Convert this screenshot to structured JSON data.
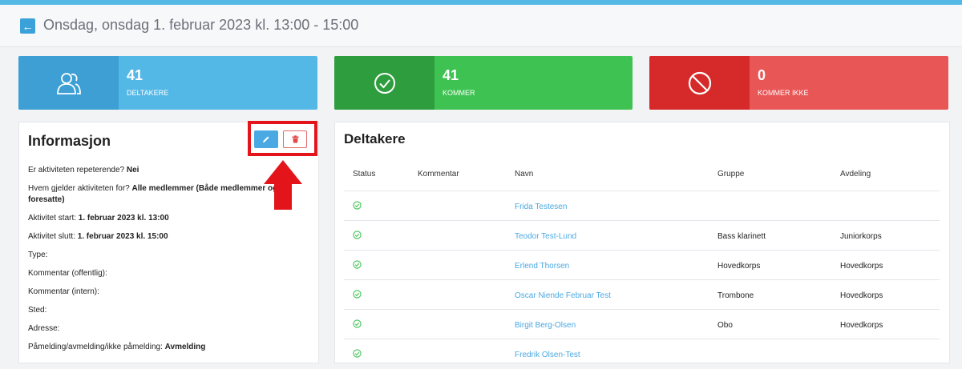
{
  "header": {
    "title": "Onsdag, onsdag 1. februar 2023 kl. 13:00 - 15:00",
    "back_icon": "arrow-left-icon"
  },
  "stats": [
    {
      "value": "41",
      "label": "DELTAKERE",
      "icon": "users-icon",
      "color": "#54b8e7"
    },
    {
      "value": "41",
      "label": "KOMMER",
      "icon": "check-circle-icon",
      "color": "#3ec252"
    },
    {
      "value": "0",
      "label": "KOMMER IKKE",
      "icon": "ban-icon",
      "color": "#e95656"
    }
  ],
  "info": {
    "title": "Informasjon",
    "rows": [
      {
        "label": "Er aktiviteten repeterende? ",
        "value": "Nei"
      },
      {
        "label": "Hvem gjelder aktiviteten for? ",
        "value": "Alle medlemmer (Både medlemmer og foresatte)"
      },
      {
        "label": "Aktivitet start: ",
        "value": "1. februar 2023 kl. 13:00"
      },
      {
        "label": "Aktivitet slutt: ",
        "value": "1. februar 2023 kl. 15:00"
      },
      {
        "label": "Type:",
        "value": ""
      },
      {
        "label": "Kommentar (offentlig):",
        "value": ""
      },
      {
        "label": "Kommentar (intern):",
        "value": ""
      },
      {
        "label": "Sted:",
        "value": ""
      },
      {
        "label": "Adresse:",
        "value": ""
      },
      {
        "label": "Påmelding/avmelding/ikke påmelding: ",
        "value": "Avmelding"
      }
    ]
  },
  "participants": {
    "title": "Deltakere",
    "columns": [
      "Status",
      "Kommentar",
      "Navn",
      "Gruppe",
      "Avdeling"
    ],
    "rows": [
      {
        "name": "Frida Testesen",
        "group": "",
        "department": ""
      },
      {
        "name": "Teodor Test-Lund",
        "group": "Bass klarinett",
        "department": "Juniorkorps"
      },
      {
        "name": "Erlend Thorsen",
        "group": "Hovedkorps",
        "department": "Hovedkorps"
      },
      {
        "name": "Oscar Niende Februar Test",
        "group": "Trombone",
        "department": "Hovedkorps"
      },
      {
        "name": "Birgit Berg-Olsen",
        "group": "Obo",
        "department": "Hovedkorps"
      },
      {
        "name": "Fredrik Olsen-Test",
        "group": "",
        "department": ""
      }
    ]
  },
  "colors": {
    "accent": "#4aa9e2",
    "highlight": "#e4141b"
  }
}
